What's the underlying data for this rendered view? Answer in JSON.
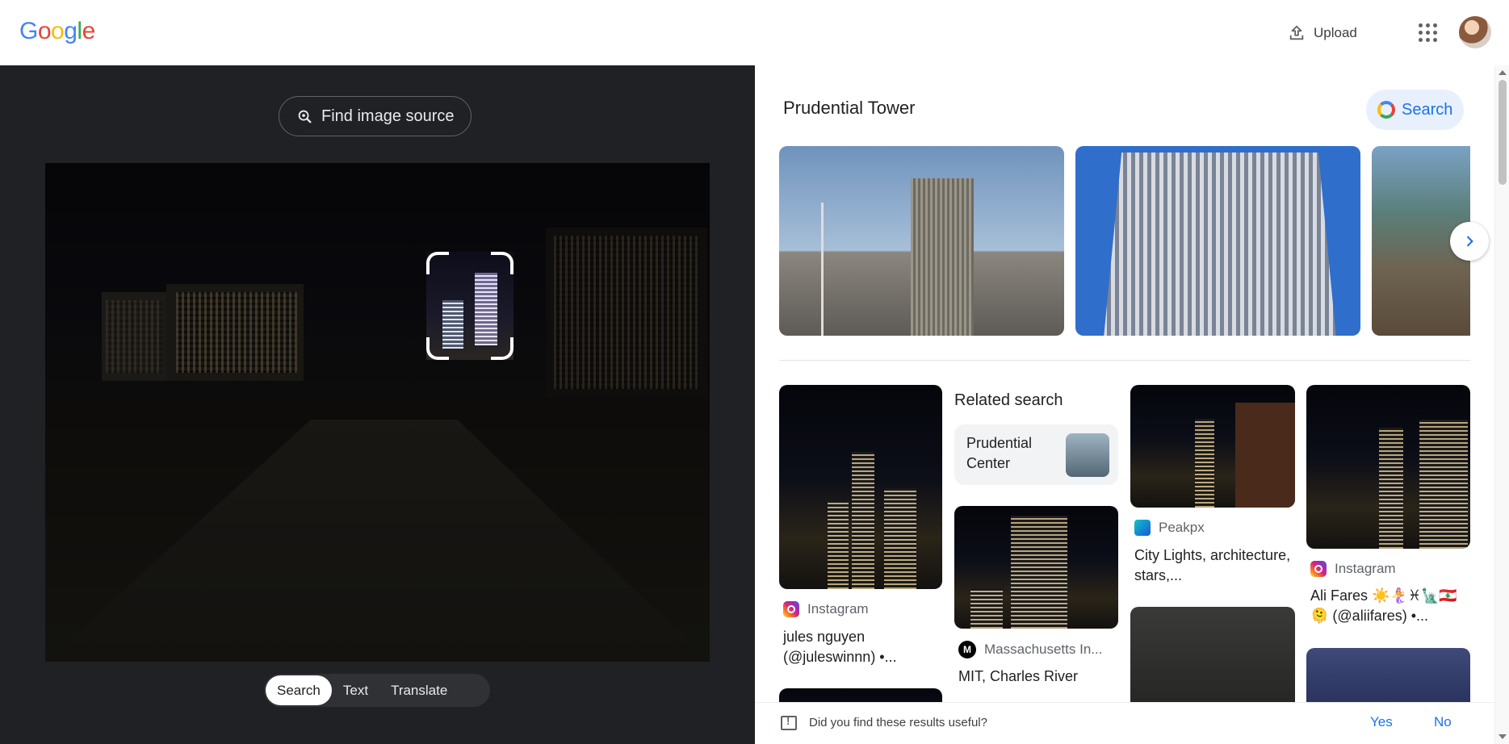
{
  "header": {
    "logo_letters": [
      {
        "ch": "G",
        "color": "#4285F4"
      },
      {
        "ch": "o",
        "color": "#EA4335"
      },
      {
        "ch": "o",
        "color": "#FBBC05"
      },
      {
        "ch": "g",
        "color": "#4285F4"
      },
      {
        "ch": "l",
        "color": "#34A853"
      },
      {
        "ch": "e",
        "color": "#EA4335"
      }
    ],
    "upload_label": "Upload",
    "apps_icon": "apps-grid-icon",
    "avatar_icon": "user-avatar"
  },
  "left_panel": {
    "find_source_label": "Find image source",
    "modes": [
      "Search",
      "Text",
      "Translate"
    ],
    "active_mode": "Search"
  },
  "results": {
    "entity_title": "Prudential Tower",
    "search_chip_label": "Search",
    "related_title": "Related search",
    "related_chip_label": "Prudential Center",
    "cards": [
      {
        "source": "Instagram",
        "caption": "jules nguyen (@juleswinnn) •..."
      },
      {
        "source": "Massachusetts In...",
        "caption": "MIT, Charles River"
      },
      {
        "source": "Peakpx",
        "caption": "City Lights, architecture, stars,..."
      },
      {
        "source": "Instagram",
        "caption": "Ali Fares ☀️🧜‍♀️♓🗽🇱🇧 🫠 (@aliifares) •..."
      }
    ]
  },
  "feedback": {
    "question": "Did you find these results useful?",
    "yes_label": "Yes",
    "no_label": "No"
  },
  "colors": {
    "accent": "#1a73e8",
    "dark_panel": "#202124"
  }
}
